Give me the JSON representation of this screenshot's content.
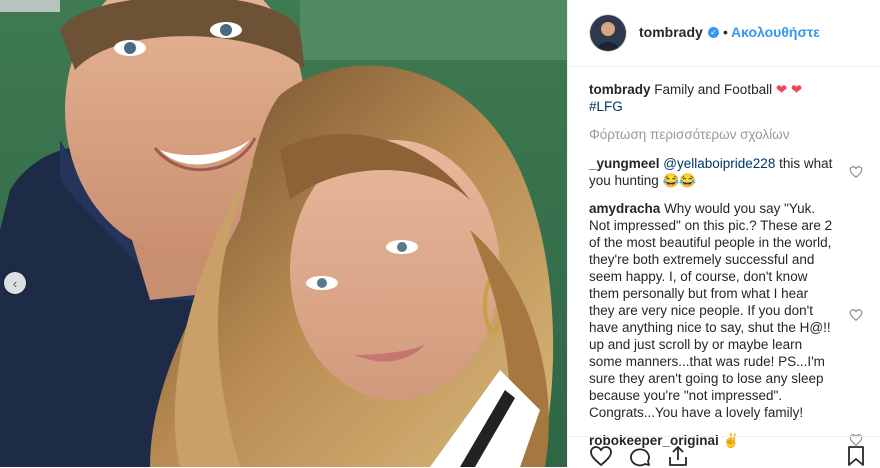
{
  "post_image": {
    "description_icon": "photo"
  },
  "header": {
    "username": "tombrady",
    "verified_icon": "verified-badge-icon",
    "separator": "•",
    "follow_label": "Ακολουθήστε"
  },
  "caption": {
    "username": "tombrady",
    "text": "Family and Football",
    "emoji": "❤ ❤",
    "hashtag": "#LFG"
  },
  "load_more_label": "Φόρτωση περισσότερων σχολίων",
  "comments": [
    {
      "username": "_yungmeel",
      "mention": "@yellaboipride228",
      "text": " this what you hunting 😂😂"
    },
    {
      "username": "amydracha",
      "text": "Why would you say \"Yuk. Not impressed\" on this pic.? These are 2 of the most beautiful people in the world, they're both extremely successful and seem happy. I, of course, don't know them personally but from what I hear they are very nice people. If you don't have anything nice to say, shut the H@!! up and just scroll by or maybe learn some manners...that was rude! PS...I'm sure they aren't going to lose any sleep because you're \"not impressed\". Congrats...You have a lovely family!"
    },
    {
      "username": "robokeeper_original",
      "text": "✌"
    }
  ],
  "colors": {
    "link_blue": "#3897f0",
    "text": "#262626",
    "muted": "#999999",
    "heart_red": "#ed4956"
  },
  "actions": [
    "heart-icon",
    "comment-icon",
    "share-icon",
    "bookmark-icon"
  ]
}
